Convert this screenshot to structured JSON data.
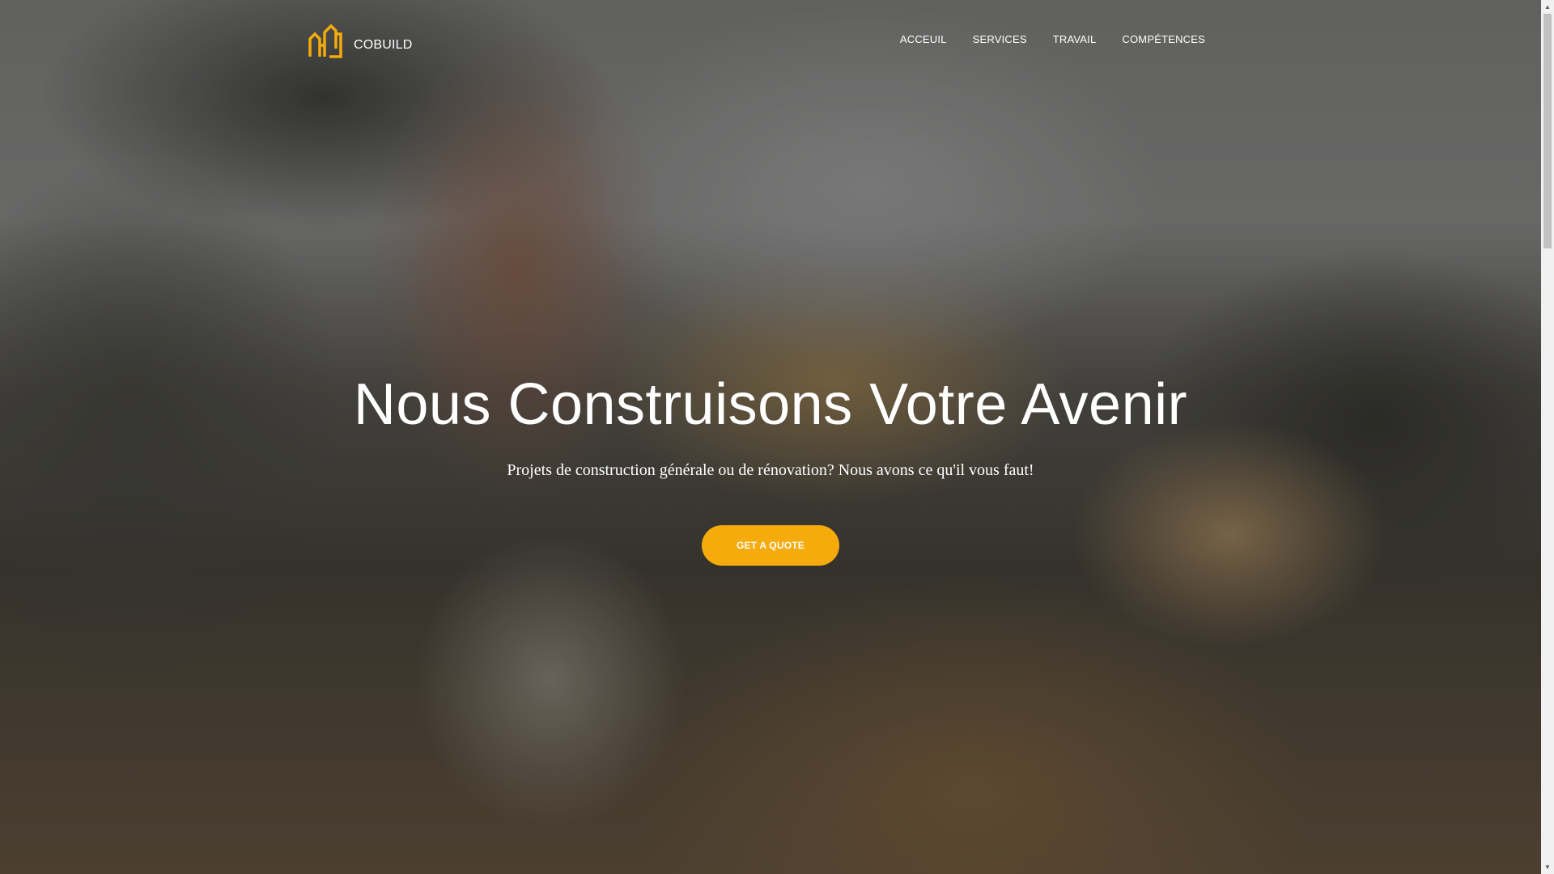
{
  "brand": {
    "name": "COBUILD",
    "logo_icon": "buildings-logo-icon",
    "accent_color": "#f5ab0b"
  },
  "nav": {
    "items": [
      {
        "label": "ACCEUIL"
      },
      {
        "label": "SERVICES"
      },
      {
        "label": "TRAVAIL"
      },
      {
        "label": "COMPÉTENCES"
      }
    ]
  },
  "hero": {
    "title": "Nous Construisons Votre Avenir",
    "subtitle": "Projets de construction générale ou de rénovation? Nous avons ce qu'il vous faut!",
    "cta_label": "GET A QUOTE",
    "cta_color": "#f5ab0b"
  },
  "scrollbar": {
    "up_icon": "scroll-up-arrow-icon",
    "down_icon": "scroll-down-arrow-icon"
  }
}
